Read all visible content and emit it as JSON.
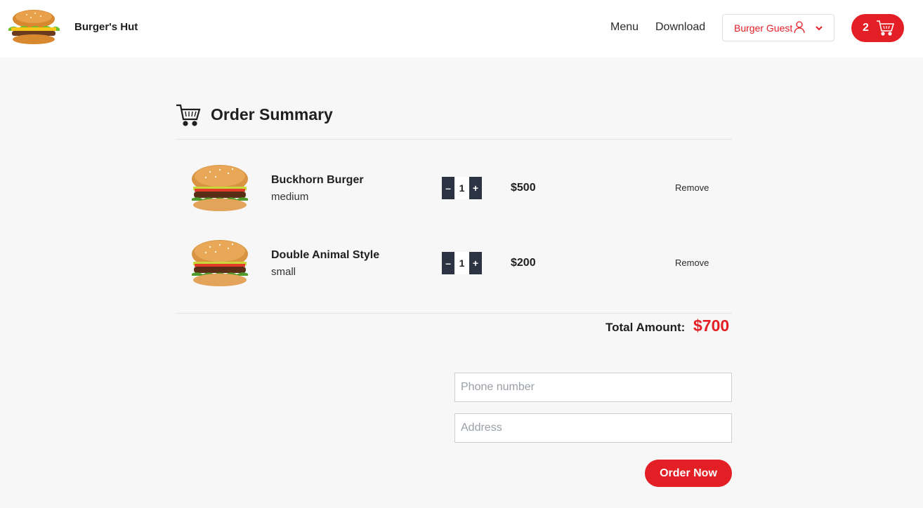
{
  "header": {
    "brand": "Burger's Hut",
    "nav": {
      "menu": "Menu",
      "download": "Download"
    },
    "user_label": "Burger Guest",
    "cart_count": "2"
  },
  "summary": {
    "title": "Order Summary",
    "items": [
      {
        "name": "Buckhorn Burger",
        "size": "medium",
        "qty": "1",
        "price": "$500",
        "remove": "Remove",
        "decrement": "–",
        "increment": "+"
      },
      {
        "name": "Double Animal Style",
        "size": "small",
        "qty": "1",
        "price": "$200",
        "remove": "Remove",
        "decrement": "–",
        "increment": "+"
      }
    ],
    "total_label": "Total Amount:",
    "total_value": "$700"
  },
  "form": {
    "phone_placeholder": "Phone number",
    "address_placeholder": "Address",
    "phone_value": "",
    "address_value": "",
    "submit_label": "Order Now"
  },
  "colors": {
    "accent": "#e31e24",
    "qty_button": "#2c3444",
    "background": "#f7f7f7"
  },
  "icons": {
    "logo": "burger-logo",
    "user": "user-icon",
    "dropdown": "chevron-down-icon",
    "cart": "cart-icon",
    "summary": "cart-icon"
  }
}
